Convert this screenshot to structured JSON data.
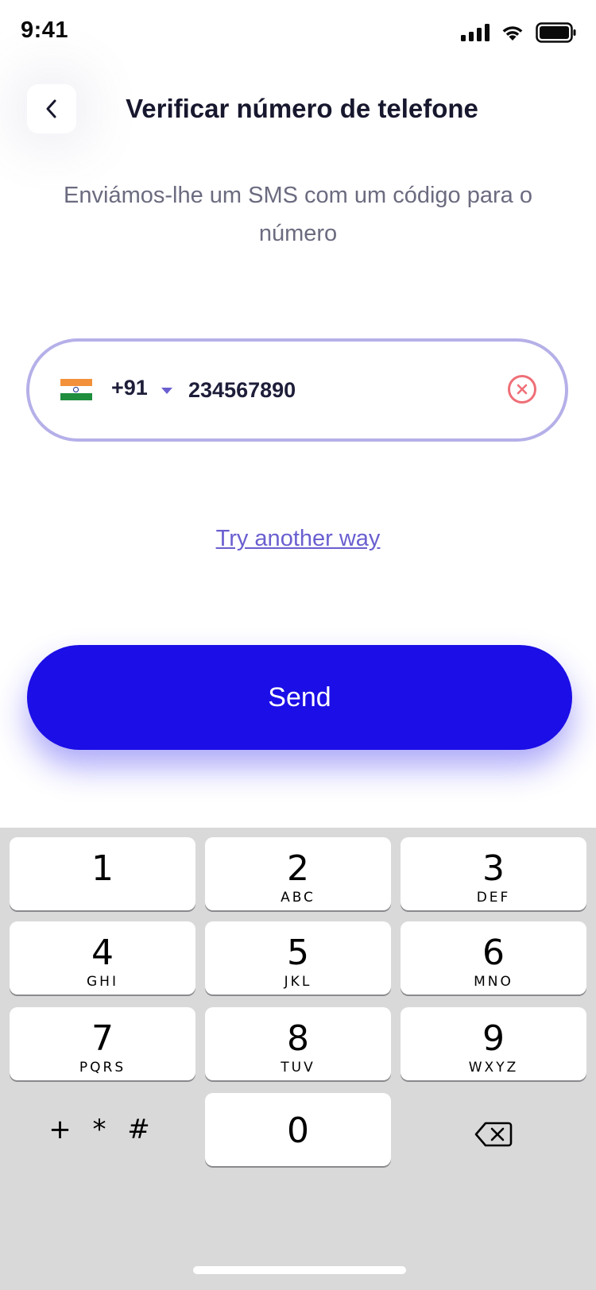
{
  "status_bar": {
    "time": "9:41"
  },
  "header": {
    "title": "Verificar número de telefone"
  },
  "subtitle": "Enviámos-lhe um SMS com um código para o número",
  "phone": {
    "country_code": "+91",
    "number": "234567890",
    "flag_colors": [
      "#F2913A",
      "#FFFFFF",
      "#1E8E3E"
    ]
  },
  "try_another_way": "Try another way",
  "send_button": "Send",
  "keypad": {
    "keys": [
      {
        "digit": "1",
        "letters": ""
      },
      {
        "digit": "2",
        "letters": "ABC"
      },
      {
        "digit": "3",
        "letters": "DEF"
      },
      {
        "digit": "4",
        "letters": "GHI"
      },
      {
        "digit": "5",
        "letters": "JKL"
      },
      {
        "digit": "6",
        "letters": "MNO"
      },
      {
        "digit": "7",
        "letters": "PQRS"
      },
      {
        "digit": "8",
        "letters": "TUV"
      },
      {
        "digit": "9",
        "letters": "WXYZ"
      },
      {
        "digit": "0",
        "letters": ""
      }
    ],
    "symbols": "+ * #"
  },
  "colors": {
    "accent": "#1B0EE6",
    "link": "#6A5FD0",
    "field_border": "#B5B0E8",
    "clear_icon": "#EF6F77"
  }
}
